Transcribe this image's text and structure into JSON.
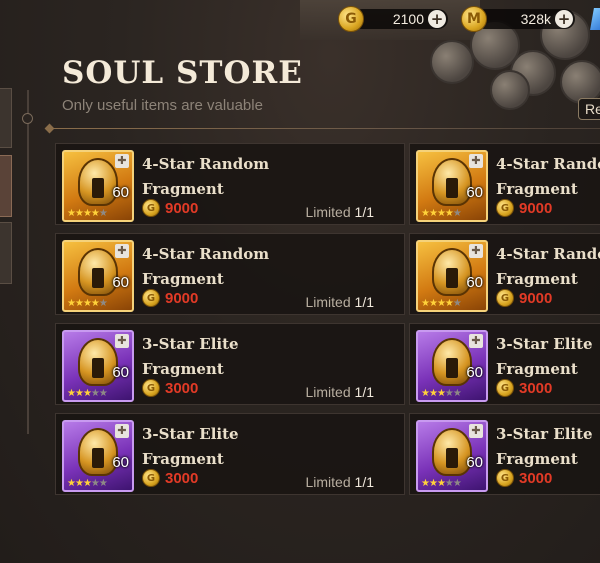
{
  "currency": {
    "gold": {
      "icon": "gold-coin-icon",
      "amount": "2100"
    },
    "second": {
      "icon": "coin-stack-icon",
      "amount": "328k"
    },
    "plus_label": "+"
  },
  "header": {
    "title": "SOUL STORE",
    "subtitle": "Only useful items are valuable",
    "refresh_label": "Re"
  },
  "items": [
    {
      "name_line1": "4-Star Random",
      "name_line2": "Fragment",
      "price": "9000",
      "qty": "60",
      "limit_label": "Limited",
      "limit_value": "1/1",
      "rarity": "gold",
      "stars": 4
    },
    {
      "name_line1": "4-Star Rando",
      "name_line2": "Fragment",
      "price": "9000",
      "qty": "60",
      "rarity": "gold",
      "stars": 4
    },
    {
      "name_line1": "4-Star Random",
      "name_line2": "Fragment",
      "price": "9000",
      "qty": "60",
      "limit_label": "Limited",
      "limit_value": "1/1",
      "rarity": "gold",
      "stars": 4
    },
    {
      "name_line1": "4-Star Rando",
      "name_line2": "Fragment",
      "price": "9000",
      "qty": "60",
      "rarity": "gold",
      "stars": 4
    },
    {
      "name_line1": "3-Star Elite",
      "name_line2": "Fragment",
      "price": "3000",
      "qty": "60",
      "limit_label": "Limited",
      "limit_value": "1/1",
      "rarity": "purple",
      "stars": 3
    },
    {
      "name_line1": "3-Star Elite",
      "name_line2": "Fragment",
      "price": "3000",
      "qty": "60",
      "rarity": "purple",
      "stars": 3
    },
    {
      "name_line1": "3-Star Elite",
      "name_line2": "Fragment",
      "price": "3000",
      "qty": "60",
      "limit_label": "Limited",
      "limit_value": "1/1",
      "rarity": "purple",
      "stars": 3
    },
    {
      "name_line1": "3-Star Elite",
      "name_line2": "Fragment",
      "price": "3000",
      "qty": "60",
      "rarity": "purple",
      "stars": 3
    }
  ],
  "colors": {
    "price": "#e23a26",
    "gold_frame": "#f6c040",
    "purple_frame": "#b77be8"
  }
}
